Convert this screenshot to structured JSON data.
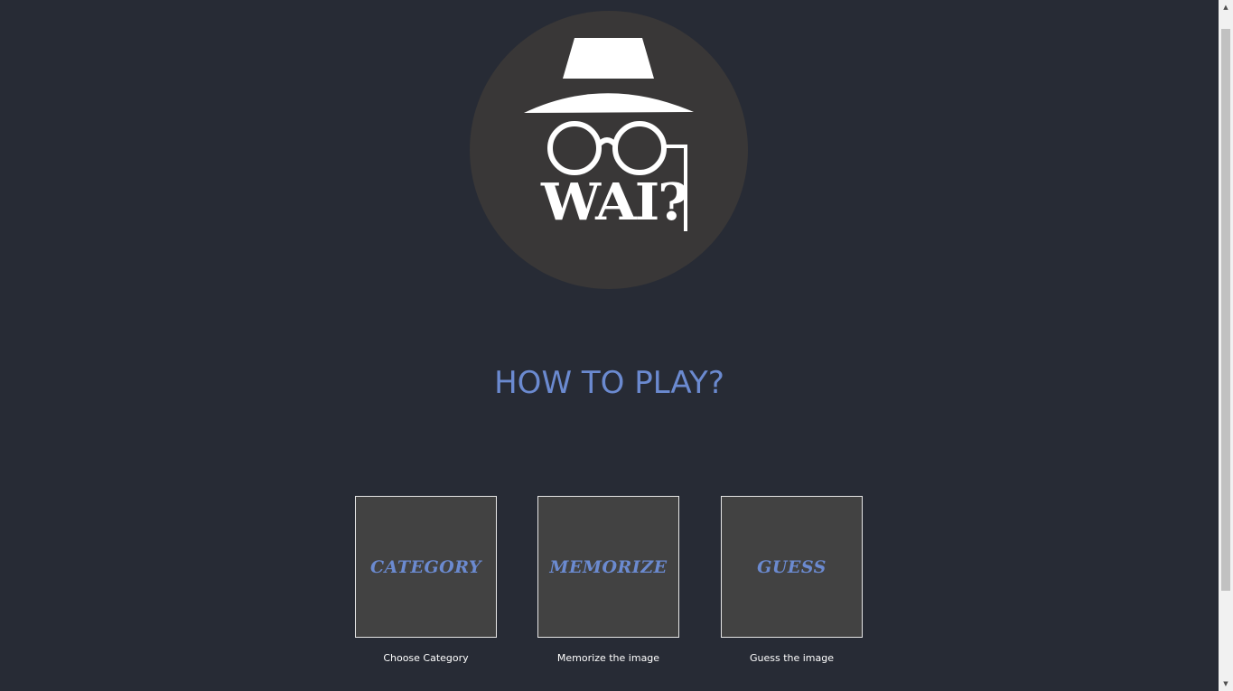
{
  "logo": {
    "text": "WAI?",
    "icon": "incognito-detective-icon"
  },
  "title": "HOW TO PLAY?",
  "steps": [
    {
      "card_label": "CATEGORY",
      "caption": "Choose Category"
    },
    {
      "card_label": "MEMORIZE",
      "caption": "Memorize the image"
    },
    {
      "card_label": "GUESS",
      "caption": "Guess the image"
    }
  ],
  "colors": {
    "background": "#272b35",
    "logo_circle": "#393737",
    "accent": "#6b8ad0",
    "card": "#424242"
  }
}
